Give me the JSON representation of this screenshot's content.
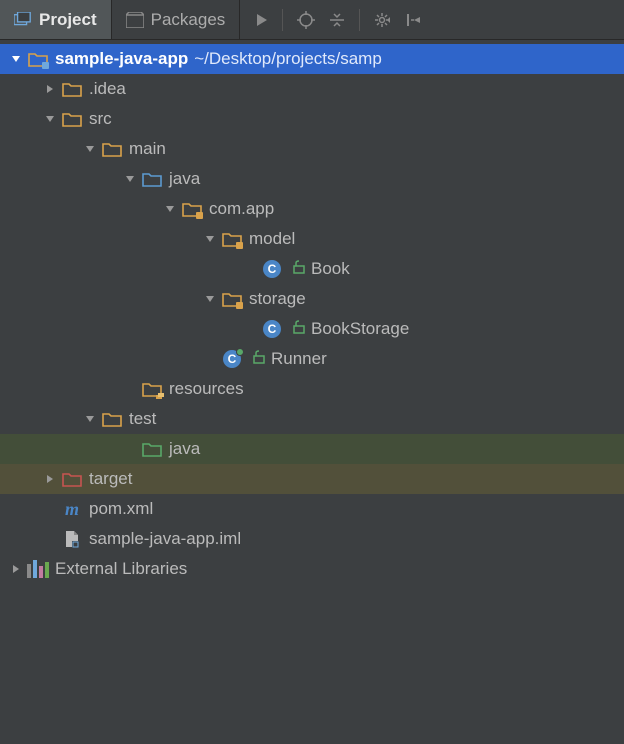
{
  "tabs": {
    "project": "Project",
    "packages": "Packages"
  },
  "tree": {
    "root": {
      "name": "sample-java-app",
      "path": "~/Desktop/projects/samp"
    },
    "idea": ".idea",
    "src": "src",
    "main": "main",
    "java_main": "java",
    "com_app": "com.app",
    "model": "model",
    "book": "Book",
    "storage": "storage",
    "book_storage": "BookStorage",
    "runner": "Runner",
    "resources": "resources",
    "test": "test",
    "java_test": "java",
    "target": "target",
    "pom": "pom.xml",
    "iml": "sample-java-app.iml",
    "ext_lib": "External Libraries"
  }
}
